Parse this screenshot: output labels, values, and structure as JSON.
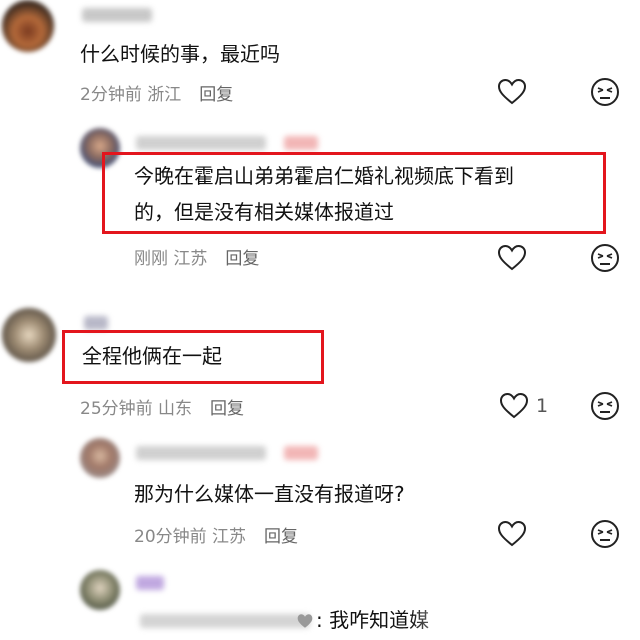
{
  "comments": [
    {
      "text": "什么时候的事，最近吗",
      "time": "2分钟前",
      "location": "浙江",
      "reply_label": "回复"
    },
    {
      "text_line1": "今晚在霍启山弟弟霍启仁婚礼视频底下看到",
      "text_line2": "的，但是没有相关媒体报道过",
      "time": "刚刚",
      "location": "江苏",
      "reply_label": "回复"
    },
    {
      "text": "全程他俩在一起",
      "time": "25分钟前",
      "location": "山东",
      "reply_label": "回复",
      "like_count": "1"
    },
    {
      "text": "那为什么媒体一直没有报道呀?",
      "time": "20分钟前",
      "location": "江苏",
      "reply_label": "回复"
    },
    {
      "text": "我咋知道媒"
    }
  ],
  "colors": {
    "highlight": "#e3151d",
    "meta": "#888888"
  },
  "icons": [
    "heart-icon",
    "dizzy-face-icon"
  ]
}
